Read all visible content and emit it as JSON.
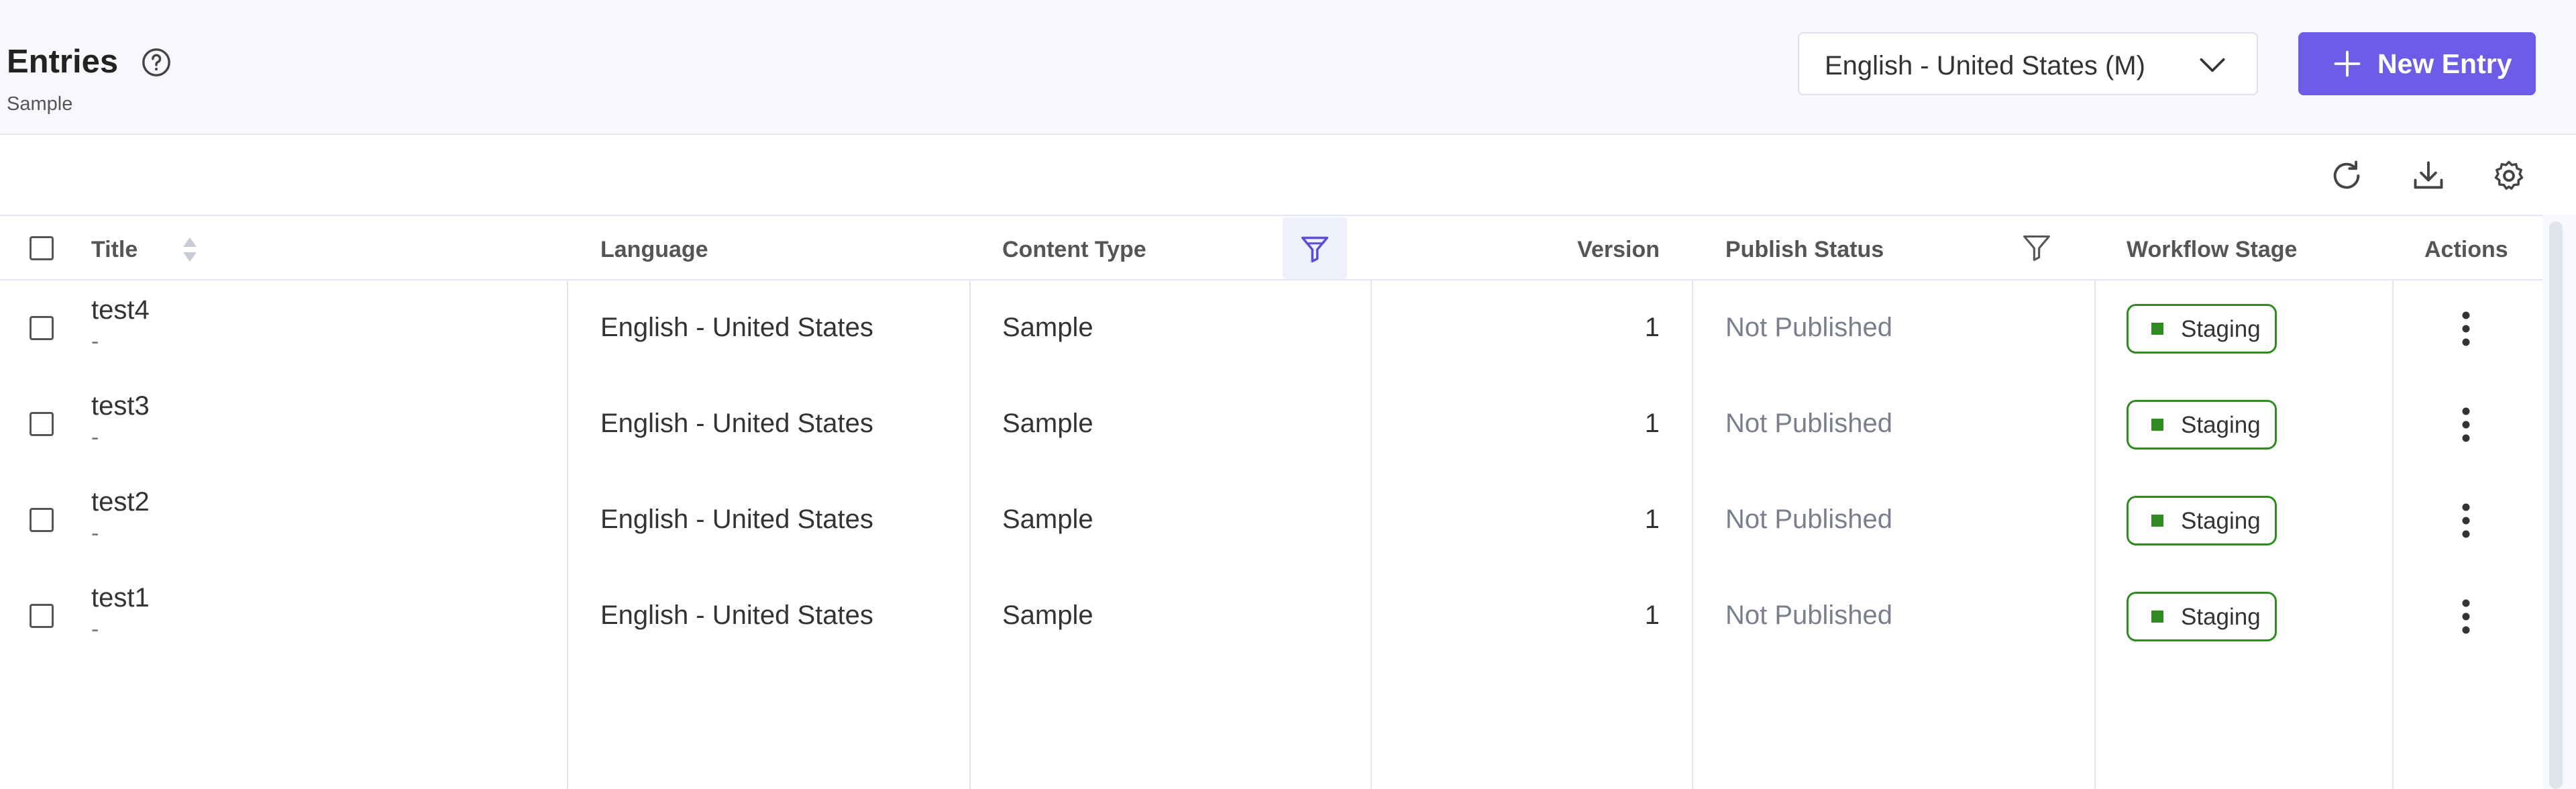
{
  "header": {
    "title": "Entries",
    "subtitle": "Sample",
    "help_icon": "question-circle-icon",
    "locale_select": {
      "value": "English - United States (M)"
    },
    "new_entry_label": "New Entry",
    "accent": "#6c5ce7"
  },
  "toolbar": {
    "icons": [
      "refresh-icon",
      "download-icon",
      "settings-gear-icon"
    ]
  },
  "table": {
    "columns": [
      "Title",
      "Language",
      "Content Type",
      "Version",
      "Publish Status",
      "Workflow Stage",
      "Actions"
    ],
    "rows": [
      {
        "title": "test4",
        "sub": "-",
        "language": "English - United States",
        "content_type": "Sample",
        "version": "1",
        "publish_status": "Not Published",
        "workflow_stage": "Staging"
      },
      {
        "title": "test3",
        "sub": "-",
        "language": "English - United States",
        "content_type": "Sample",
        "version": "1",
        "publish_status": "Not Published",
        "workflow_stage": "Staging"
      },
      {
        "title": "test2",
        "sub": "-",
        "language": "English - United States",
        "content_type": "Sample",
        "version": "1",
        "publish_status": "Not Published",
        "workflow_stage": "Staging"
      },
      {
        "title": "test1",
        "sub": "-",
        "language": "English - United States",
        "content_type": "Sample",
        "version": "1",
        "publish_status": "Not Published",
        "workflow_stage": "Staging"
      }
    ],
    "stage_color": "#2e8b1e"
  }
}
